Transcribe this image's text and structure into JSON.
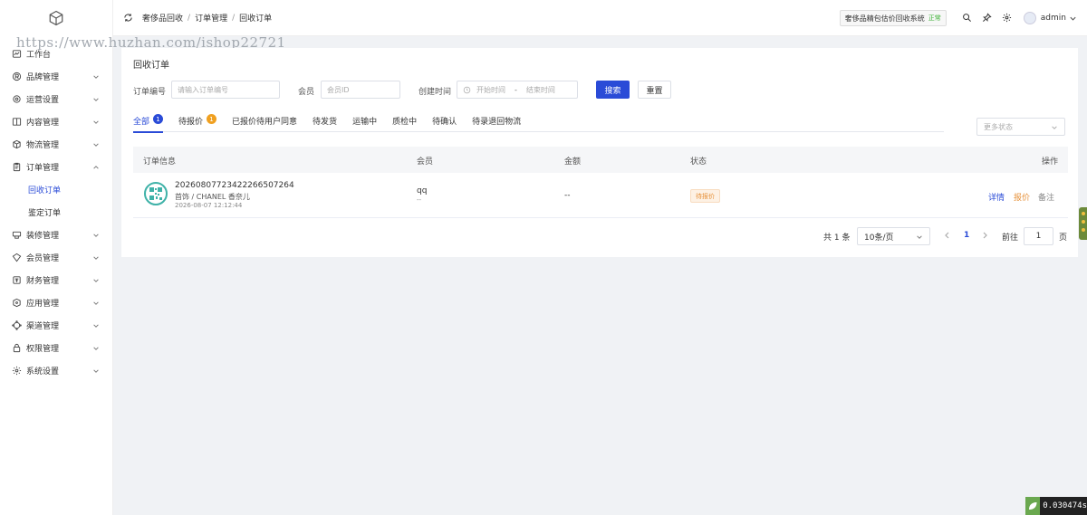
{
  "watermark": "https://www.huzhan.com/ishop22721",
  "sidebar": {
    "items": [
      {
        "label": "工作台",
        "icon": "dashboard-icon",
        "has_children": false
      },
      {
        "label": "品牌管理",
        "icon": "registered-icon",
        "has_children": true
      },
      {
        "label": "运营设置",
        "icon": "settings-icon",
        "has_children": true
      },
      {
        "label": "内容管理",
        "icon": "book-icon",
        "has_children": true
      },
      {
        "label": "物流管理",
        "icon": "box-icon",
        "has_children": true
      },
      {
        "label": "订单管理",
        "icon": "clipboard-icon",
        "has_children": true,
        "expanded": true,
        "children": [
          {
            "label": "回收订单",
            "active": true
          },
          {
            "label": "鉴定订单",
            "active": false
          }
        ]
      },
      {
        "label": "装修管理",
        "icon": "decorate-icon",
        "has_children": true
      },
      {
        "label": "会员管理",
        "icon": "member-icon",
        "has_children": true
      },
      {
        "label": "财务管理",
        "icon": "finance-icon",
        "has_children": true
      },
      {
        "label": "应用管理",
        "icon": "app-icon",
        "has_children": true
      },
      {
        "label": "渠道管理",
        "icon": "channel-icon",
        "has_children": true
      },
      {
        "label": "权限管理",
        "icon": "lock-icon",
        "has_children": true
      },
      {
        "label": "系统设置",
        "icon": "gear-icon",
        "has_children": true
      }
    ]
  },
  "header": {
    "breadcrumb": [
      "奢侈品回收",
      "订单管理",
      "回收订单"
    ],
    "system_name": "奢侈品精包估价回收系统",
    "system_status": "正常",
    "username": "admin"
  },
  "page": {
    "title": "回收订单",
    "filters": {
      "order_no_label": "订单编号",
      "order_no_placeholder": "请输入订单编号",
      "member_label": "会员",
      "member_placeholder": "会员ID",
      "created_label": "创建时间",
      "start_placeholder": "开始时间",
      "range_sep": "-",
      "end_placeholder": "结束时间",
      "search_label": "搜索",
      "reset_label": "重置"
    },
    "tabs": [
      {
        "label": "全部",
        "badge": "1",
        "active": true
      },
      {
        "label": "待报价",
        "badge": "1",
        "active": false
      },
      {
        "label": "已报价待用户同意",
        "badge": "",
        "active": false
      },
      {
        "label": "待发货",
        "badge": "",
        "active": false
      },
      {
        "label": "运输中",
        "badge": "",
        "active": false
      },
      {
        "label": "质检中",
        "badge": "",
        "active": false
      },
      {
        "label": "待确认",
        "badge": "",
        "active": false
      },
      {
        "label": "待录退回物流",
        "badge": "",
        "active": false
      }
    ],
    "more_status_placeholder": "更多状态",
    "table": {
      "columns": [
        "订单信息",
        "会员",
        "金额",
        "状态",
        "操作"
      ],
      "rows": [
        {
          "order_no": "20260807723422266507264",
          "product": "首饰 / CHANEL 香奈儿",
          "created_at": "2026-08-07 12:12:44",
          "member_name": "qq",
          "member_sub": "--",
          "amount": "--",
          "status": "待报价",
          "actions": {
            "detail": "详情",
            "quote": "报价",
            "remark": "备注"
          }
        }
      ]
    },
    "pagination": {
      "total_text": "共 1 条",
      "page_size": "10条/页",
      "current_page": "1",
      "goto_label": "前往",
      "goto_value": "1",
      "page_unit": "页"
    }
  },
  "timer": "0.030474s",
  "colors": {
    "primary": "#2a4bd7",
    "warning": "#e6913a",
    "success": "#3cb035"
  }
}
